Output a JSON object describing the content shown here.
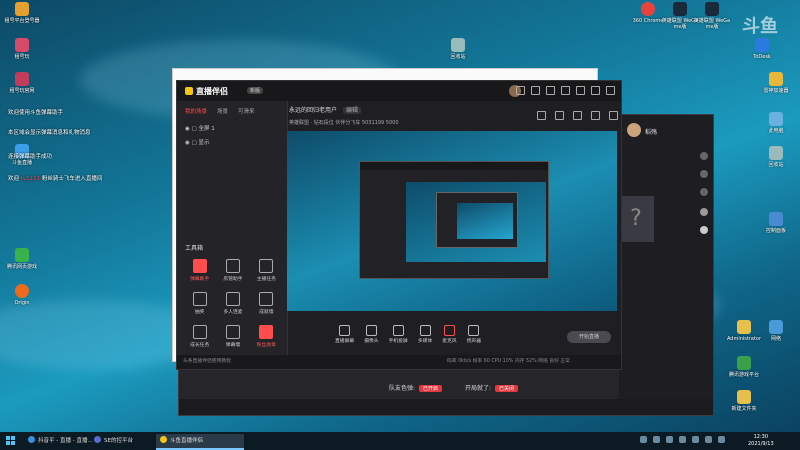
{
  "desktop_left": [
    {
      "label": "租号平台登号器"
    },
    {
      "label": "租号玩"
    },
    {
      "label": "租号玩官网"
    },
    {
      "label": "斗鱼直播"
    },
    {
      "label": "腾讯网页游戏"
    },
    {
      "label": "Origin"
    }
  ],
  "scroll_messages": [
    {
      "text": "欢迎使用斗鱼弹幕助手"
    },
    {
      "text": "本区域会显示弹幕消息和礼物消息"
    },
    {
      "text": "连接弹幕助手成功"
    },
    {
      "pre": "欢迎 ",
      "highlight": "tv1111",
      "post": " 粉丝骑士飞车进入直播间"
    }
  ],
  "desktop_right_top": [
    {
      "label": "360 Chrome"
    },
    {
      "label": "英雄联盟 WeGame版"
    },
    {
      "label": "英雄联盟 WeGame版"
    },
    {
      "label": "ToDesk"
    },
    {
      "label": "雷神加速器"
    }
  ],
  "desktop_right": [
    {
      "label": "此电脑"
    },
    {
      "label": "回收站"
    },
    {
      "label": "控制面板"
    },
    {
      "label": "Administrator"
    },
    {
      "label": "网络"
    },
    {
      "label": "腾讯游戏平台"
    },
    {
      "label": "新建文件夹"
    }
  ],
  "desktop_mid_icon": {
    "label": "回收站"
  },
  "main_app": {
    "logo": "直播伴侣",
    "version": "新版",
    "tabs": [
      "我的场景",
      "场景",
      "可滑来"
    ],
    "scenes": [
      "全屏 1",
      "显示"
    ],
    "tools_title": "工具箱",
    "tools": [
      {
        "label": "弹幕助手",
        "hot": true
      },
      {
        "label": "房管助手",
        "hot": false
      },
      {
        "label": "主播任务",
        "hot": false
      },
      {
        "label": "抽奖",
        "hot": false
      },
      {
        "label": "多人连麦",
        "hot": false
      },
      {
        "label": "成就墙",
        "hot": false
      },
      {
        "label": "成长任务",
        "hot": false
      },
      {
        "label": "弹幕墙",
        "hot": false
      },
      {
        "label": "粉丝勋章",
        "hot": true
      }
    ],
    "stream_title": "永远的回归老用户",
    "stream_tag": "编辑",
    "info_line": "英雄联盟 · 钻石段位   伙伴分飞车   5031199   5000",
    "bottom_tools": [
      "直播屏幕",
      "摄像头",
      "手机投屏",
      "多媒体",
      "麦克风",
      "扬声器"
    ],
    "go_live": "开始直播",
    "status_left": "头条直播伴侣使用教程",
    "status_right": "码率 0kb/s   帧率 60   CPU 10%   内存 52%   网络 良好   正常"
  },
  "back_window": {
    "user": "稻殇",
    "row1_label": "队友色弹:",
    "row1_badge": "已开启",
    "row2_label": "开局就了:",
    "row2_badge": "已关闭"
  },
  "taskbar": {
    "items": [
      {
        "label": "抖音平 - 直播 - 直播..."
      },
      {
        "label": "SE的控平台"
      },
      {
        "label": "斗鱼直播伴侣",
        "active": true
      }
    ],
    "time": "12:30",
    "date": "2021/9/13",
    "watermark": "斗鱼"
  },
  "colors": {
    "accent": "#ff4d4d",
    "taskbar": "#0c1a24"
  }
}
